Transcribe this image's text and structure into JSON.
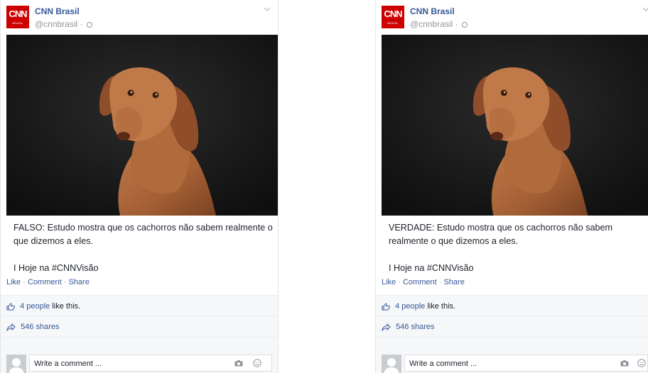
{
  "posts": [
    {
      "page_name": "CNN Brasil",
      "handle": "@cnnbrasil",
      "logo_text": "CNN",
      "logo_sub": "BRASIL",
      "caption_line1": "FALSO: Estudo mostra que os cachorros não sabem realmente o que dizemos a eles.",
      "caption_line2": "I Hoje na #CNNVisão",
      "actions": {
        "like": "Like",
        "comment": "Comment",
        "share": "Share"
      },
      "likes_count": "4 people",
      "likes_suffix": " like this.",
      "shares": "546 shares",
      "comment_placeholder": "Write a comment ..."
    },
    {
      "page_name": "CNN Brasil",
      "handle": "@cnnbrasil",
      "logo_text": "CNN",
      "logo_sub": "BRASIL",
      "caption_line1": "VERDADE: Estudo mostra que os cachorros não sabem realmente o que dizemos a eles.",
      "caption_line2": "I Hoje na #CNNVisão",
      "actions": {
        "like": "Like",
        "comment": "Comment",
        "share": "Share"
      },
      "likes_count": "4 people",
      "likes_suffix": " like this.",
      "shares": "546 shares",
      "comment_placeholder": "Write a comment ..."
    }
  ],
  "icons": {
    "globe": "globe-icon",
    "chevron": "chevron-down-icon",
    "thumb": "thumbs-up-icon",
    "share": "share-arrow-icon",
    "camera": "camera-icon",
    "emoji": "emoji-icon"
  },
  "colors": {
    "brand": "#cc0000",
    "link": "#365899",
    "muted": "#90949c"
  }
}
